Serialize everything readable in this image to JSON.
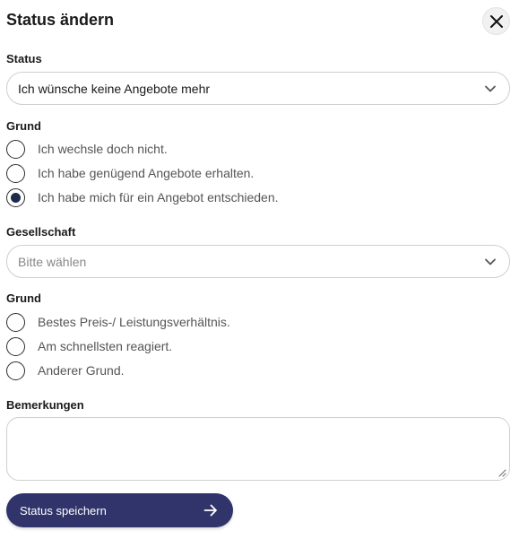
{
  "dialog": {
    "title": "Status ändern"
  },
  "status": {
    "label": "Status",
    "selected": "Ich wünsche keine Angebote mehr"
  },
  "reason1": {
    "label": "Grund",
    "options": [
      {
        "text": "Ich wechsle doch nicht.",
        "checked": false
      },
      {
        "text": "Ich habe genügend Angebote erhalten.",
        "checked": false
      },
      {
        "text": "Ich habe mich für ein Angebot entschieden.",
        "checked": true
      }
    ]
  },
  "company": {
    "label": "Gesellschaft",
    "placeholder": "Bitte wählen"
  },
  "reason2": {
    "label": "Grund",
    "options": [
      {
        "text": "Bestes Preis-/ Leistungsverhältnis.",
        "checked": false
      },
      {
        "text": "Am schnellsten reagiert.",
        "checked": false
      },
      {
        "text": "Anderer Grund.",
        "checked": false
      }
    ]
  },
  "remarks": {
    "label": "Bemerkungen",
    "value": ""
  },
  "submit": {
    "label": "Status speichern"
  },
  "colors": {
    "button_bg": "#30346b",
    "radio_selected": "#1e2a4a"
  },
  "icons": {
    "close": "close-icon",
    "chevron": "chevron-down-icon",
    "arrow": "arrow-right-icon",
    "resize": "resize-handle-icon"
  }
}
